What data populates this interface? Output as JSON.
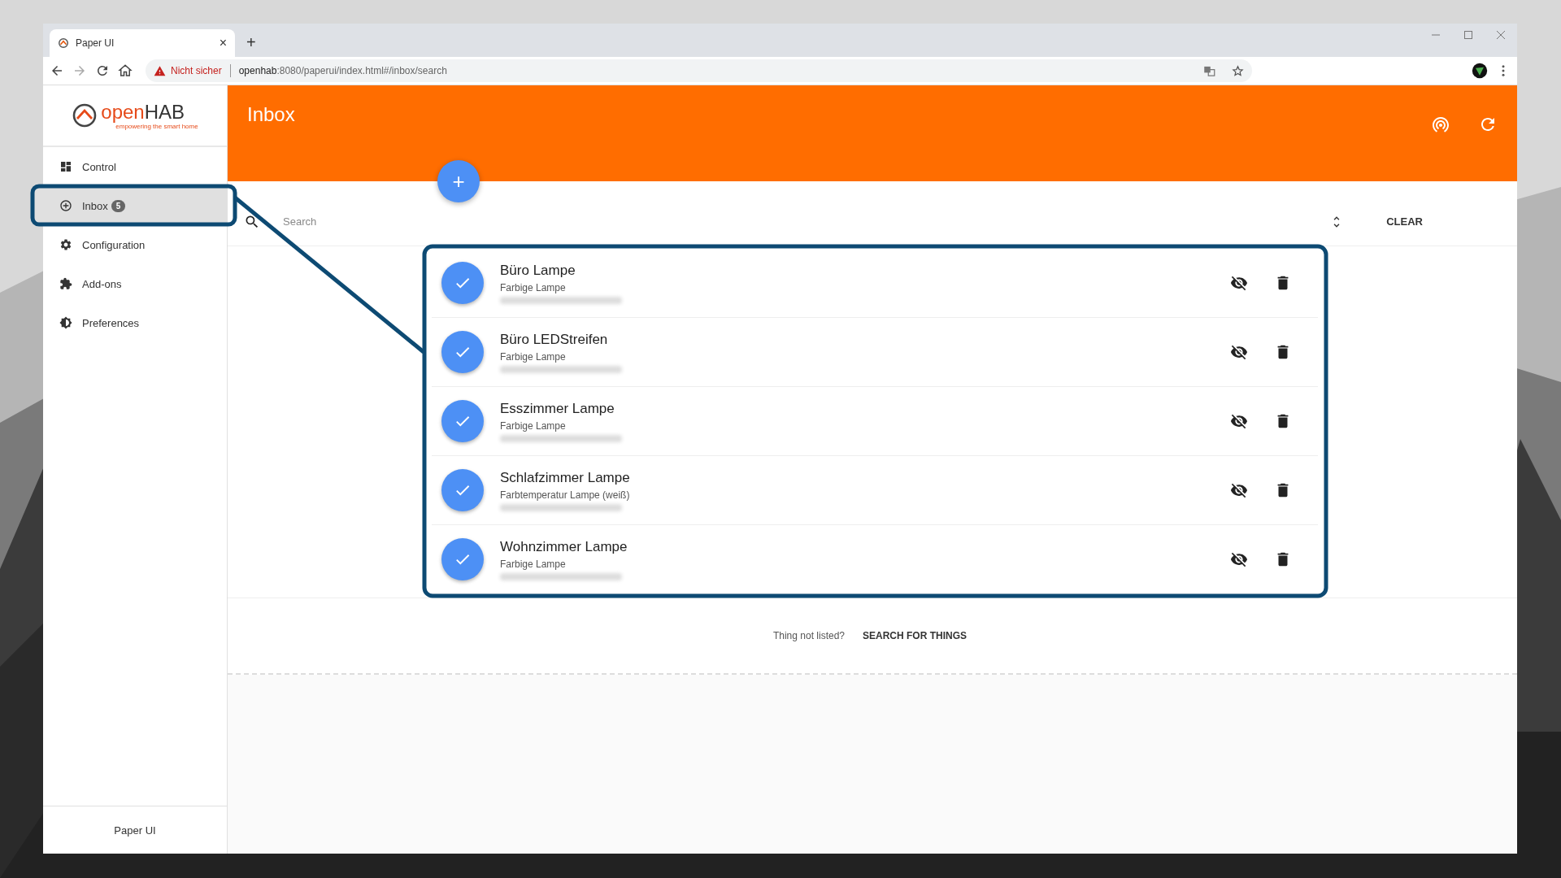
{
  "browser": {
    "tab_title": "Paper UI",
    "tab_close": "×",
    "new_tab": "+",
    "security": "Nicht sicher",
    "url_host": "openhab",
    "url_rest": ":8080/paperui/index.html#/inbox/search"
  },
  "sidebar": {
    "logo": {
      "open": "open",
      "hab": "HAB",
      "tagline": "empowering the smart home"
    },
    "items": [
      {
        "label": "Control",
        "selected": false
      },
      {
        "label": "Inbox",
        "badge": "5",
        "selected": true
      },
      {
        "label": "Configuration",
        "selected": false
      },
      {
        "label": "Add-ons",
        "selected": false
      },
      {
        "label": "Preferences",
        "selected": false
      }
    ],
    "footer": "Paper UI"
  },
  "header": {
    "title": "Inbox"
  },
  "fab": "+",
  "search": {
    "placeholder": "Search",
    "clear": "CLEAR"
  },
  "things": [
    {
      "name": "Büro Lampe",
      "type": "Farbige Lampe"
    },
    {
      "name": "Büro LEDStreifen",
      "type": "Farbige Lampe"
    },
    {
      "name": "Esszimmer Lampe",
      "type": "Farbige Lampe"
    },
    {
      "name": "Schlafzimmer Lampe",
      "type": "Farbtemperatur Lampe (weiß)"
    },
    {
      "name": "Wohnzimmer Lampe",
      "type": "Farbige Lampe"
    }
  ],
  "footer": {
    "question": "Thing not listed?",
    "action": "SEARCH FOR THINGS"
  }
}
